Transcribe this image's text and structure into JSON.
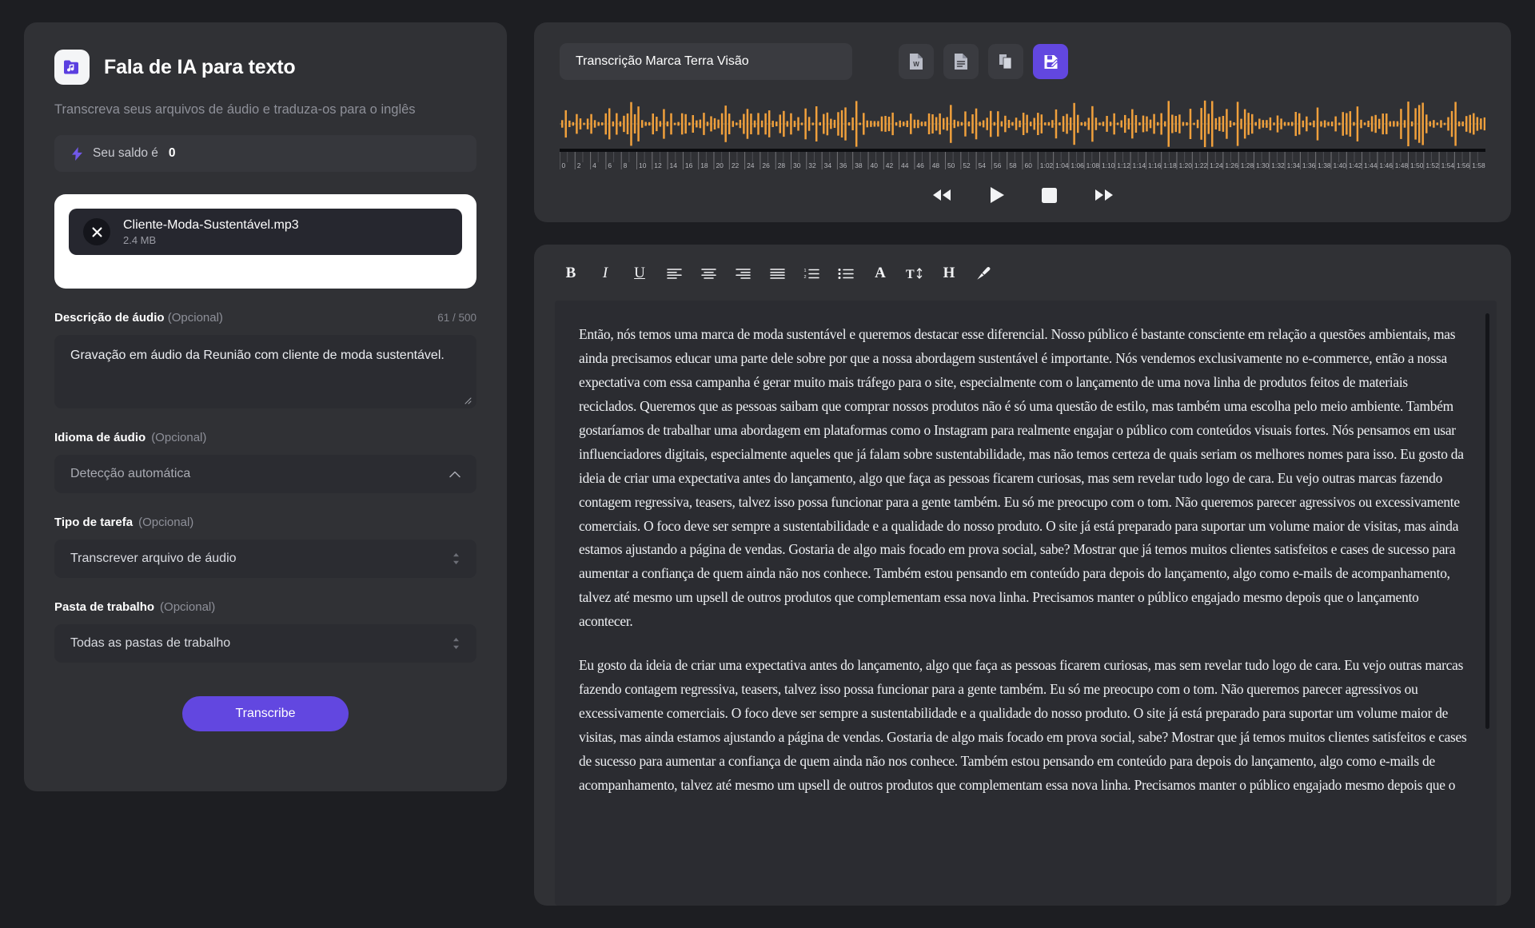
{
  "brand": {
    "title": "Fala de IA para texto",
    "subtitle": "Transcreva seus arquivos de áudio e traduza-os para o inglês",
    "icon": "music-folder-icon"
  },
  "balance": {
    "prefix": "Seu saldo é",
    "value": "0",
    "icon": "bolt-icon"
  },
  "file": {
    "name": "Cliente-Moda-Sustentável.mp3",
    "size": "2.4 MB",
    "remove_icon": "close-icon"
  },
  "description": {
    "label": "Descrição de áudio",
    "optional": "(Opcional)",
    "counter": "61 / 500",
    "value": "Gravação em áudio da Reunião com cliente de moda sustentável."
  },
  "language": {
    "label": "Idioma de áudio",
    "optional": "(Opcional)",
    "value": "Detecção automática",
    "icon": "chevron-up-icon"
  },
  "task": {
    "label": "Tipo de tarefa",
    "optional": "(Opcional)",
    "value": "Transcrever arquivo de áudio",
    "icon": "selector-icon"
  },
  "workspace": {
    "label": "Pasta de trabalho",
    "optional": "(Opcional)",
    "value": "Todas as pastas de trabalho",
    "icon": "selector-icon"
  },
  "submit": {
    "label": "Transcribe"
  },
  "player": {
    "title_value": "Transcrição Marca Terra Visão",
    "title_placeholder": "Transcrição Marca Terra Visão",
    "actions": [
      {
        "name": "export-word-button",
        "icon": "word-file-icon"
      },
      {
        "name": "export-doc-button",
        "icon": "text-file-icon"
      },
      {
        "name": "copy-button",
        "icon": "copy-icon"
      },
      {
        "name": "save-edit-button",
        "icon": "save-edit-icon"
      }
    ],
    "transport": [
      {
        "name": "rewind-button",
        "icon": "rewind-icon"
      },
      {
        "name": "play-button",
        "icon": "play-icon"
      },
      {
        "name": "stop-button",
        "icon": "stop-icon"
      },
      {
        "name": "forward-button",
        "icon": "fast-forward-icon"
      }
    ],
    "ruler_labels": [
      "0",
      "2",
      "4",
      "6",
      "8",
      "10",
      "12",
      "14",
      "16",
      "18",
      "20",
      "22",
      "24",
      "26",
      "28",
      "30",
      "32",
      "34",
      "36",
      "38",
      "40",
      "42",
      "44",
      "46",
      "48",
      "50",
      "52",
      "54",
      "56",
      "58",
      "60",
      "1:02",
      "1:04",
      "1:06",
      "1:08",
      "1:10",
      "1:12",
      "1:14",
      "1:16",
      "1:18",
      "1:20",
      "1:22",
      "1:24",
      "1:26",
      "1:28",
      "1:30",
      "1:32",
      "1:34",
      "1:36",
      "1:38",
      "1:40",
      "1:42",
      "1:44",
      "1:46",
      "1:48",
      "1:50",
      "1:52",
      "1:54",
      "1:56",
      "1:58"
    ],
    "waveform_color": "#f0a03c"
  },
  "toolbar": [
    {
      "name": "bold-button",
      "glyph": "B"
    },
    {
      "name": "italic-button",
      "glyph": "I"
    },
    {
      "name": "underline-button",
      "glyph": "U"
    },
    {
      "name": "align-left-button",
      "glyph": "align-left-icon"
    },
    {
      "name": "align-center-button",
      "glyph": "align-center-icon"
    },
    {
      "name": "align-right-button",
      "glyph": "align-right-icon"
    },
    {
      "name": "align-justify-button",
      "glyph": "align-justify-icon"
    },
    {
      "name": "ordered-list-button",
      "glyph": "ordered-list-icon"
    },
    {
      "name": "bullet-list-button",
      "glyph": "bullet-list-icon"
    },
    {
      "name": "text-color-button",
      "glyph": "A"
    },
    {
      "name": "font-size-button",
      "glyph": "font-size-icon"
    },
    {
      "name": "heading-button",
      "glyph": "H"
    },
    {
      "name": "highlighter-button",
      "glyph": "brush-icon"
    }
  ],
  "transcript": {
    "paragraph_1": "Então, nós temos uma marca de moda sustentável e queremos destacar esse diferencial. Nosso público é bastante consciente em relação a questões ambientais, mas ainda precisamos educar uma parte dele sobre por que a nossa abordagem sustentável é importante. Nós vendemos exclusivamente no e-commerce, então a nossa expectativa com essa campanha é gerar muito mais tráfego para o site, especialmente com o lançamento de uma nova linha de produtos feitos de materiais reciclados. Queremos que as pessoas saibam que comprar nossos produtos não é só uma questão de estilo, mas também uma escolha pelo meio ambiente. Também gostaríamos de trabalhar uma abordagem em plataformas como o Instagram para realmente engajar o público com conteúdos visuais fortes. Nós pensamos em usar influenciadores digitais, especialmente aqueles que já falam sobre sustentabilidade, mas não temos certeza de quais seriam os melhores nomes para isso. Eu gosto da ideia de criar uma expectativa antes do lançamento, algo que faça as pessoas ficarem curiosas, mas sem revelar tudo logo de cara. Eu vejo outras marcas fazendo contagem regressiva, teasers, talvez isso possa funcionar para a gente também. Eu só me preocupo com o tom. Não queremos parecer agressivos ou excessivamente comerciais. O foco deve ser sempre a sustentabilidade e a qualidade do nosso produto. O site já está preparado para suportar um volume maior de visitas, mas ainda estamos ajustando a página de vendas. Gostaria de algo mais focado em prova social, sabe? Mostrar que já temos muitos clientes satisfeitos e cases de sucesso para aumentar a confiança de quem ainda não nos conhece. Também estou pensando em conteúdo para depois do lançamento, algo como e-mails de acompanhamento, talvez até mesmo um upsell de outros produtos que complementam essa nova linha. Precisamos manter o público engajado mesmo depois que o lançamento acontecer.",
    "paragraph_2": "Eu gosto da ideia de criar uma expectativa antes do lançamento, algo que faça as pessoas ficarem curiosas, mas sem revelar tudo logo de cara. Eu vejo outras marcas fazendo contagem regressiva, teasers, talvez isso possa funcionar para a gente também. Eu só me preocupo com o tom. Não queremos parecer agressivos ou excessivamente comerciais. O foco deve ser sempre a sustentabilidade e a qualidade do nosso produto. O site já está preparado para suportar um volume maior de visitas, mas ainda estamos ajustando a página de vendas. Gostaria de algo mais focado em prova social, sabe? Mostrar que já temos muitos clientes satisfeitos e cases de sucesso para aumentar a confiança de quem ainda não nos conhece. Também estou pensando em conteúdo para depois do lançamento, algo como e-mails de acompanhamento, talvez até mesmo um upsell de outros produtos que complementam essa nova linha. Precisamos manter o público engajado mesmo depois que o"
  },
  "colors": {
    "accent": "#6247e0",
    "panel": "#303135",
    "page": "#1d1e22",
    "waveform": "#f0a03c"
  }
}
